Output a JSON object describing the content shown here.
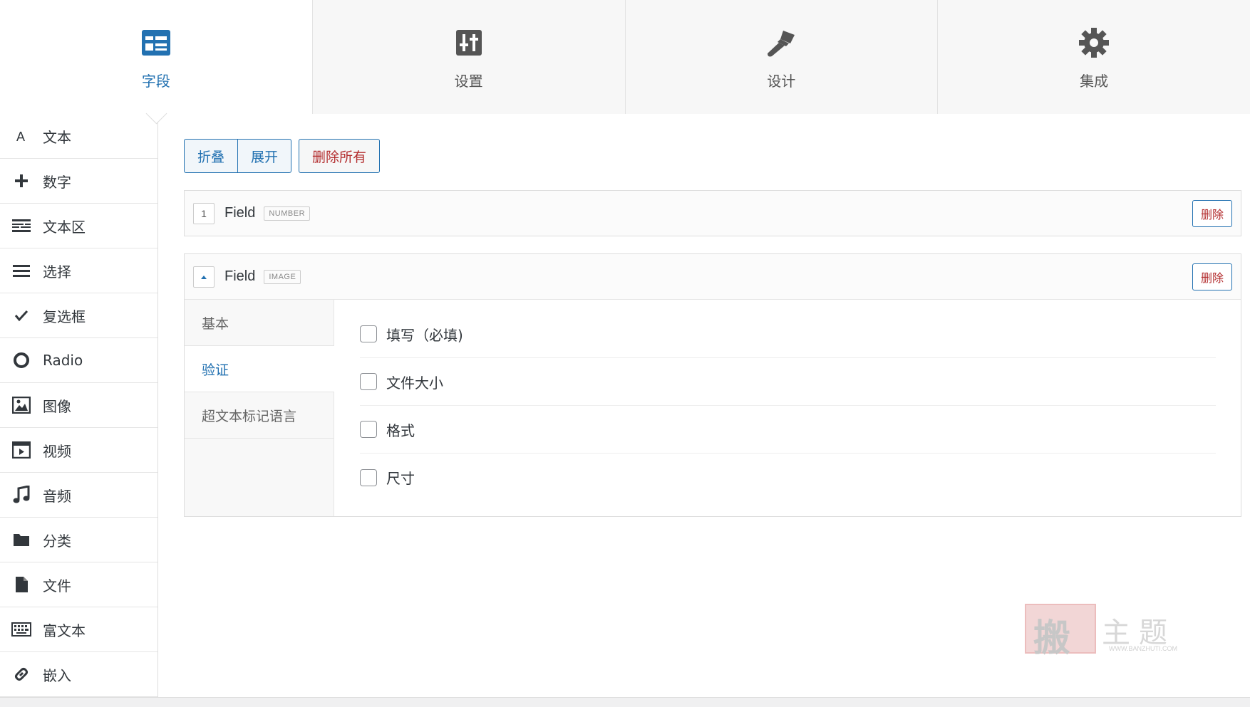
{
  "tabs": [
    {
      "label": "字段",
      "icon": "fields-icon",
      "active": true
    },
    {
      "label": "设置",
      "icon": "sliders-icon",
      "active": false
    },
    {
      "label": "设计",
      "icon": "brush-icon",
      "active": false
    },
    {
      "label": "集成",
      "icon": "gear-icon",
      "active": false
    }
  ],
  "sidebar": {
    "items": [
      {
        "label": "文本",
        "icon": "text-icon"
      },
      {
        "label": "数字",
        "icon": "plus-icon"
      },
      {
        "label": "文本区",
        "icon": "textarea-icon"
      },
      {
        "label": "选择",
        "icon": "menu-icon"
      },
      {
        "label": "复选框",
        "icon": "checkmark-icon"
      },
      {
        "label": "Radio",
        "icon": "radio-icon"
      },
      {
        "label": "图像",
        "icon": "image-icon"
      },
      {
        "label": "视频",
        "icon": "video-icon"
      },
      {
        "label": "音频",
        "icon": "music-icon"
      },
      {
        "label": "分类",
        "icon": "folder-icon"
      },
      {
        "label": "文件",
        "icon": "file-icon"
      },
      {
        "label": "富文本",
        "icon": "keyboard-icon"
      },
      {
        "label": "嵌入",
        "icon": "link-icon"
      }
    ]
  },
  "toolbar": {
    "collapse_label": "折叠",
    "expand_label": "展开",
    "delete_all_label": "删除所有"
  },
  "fields": [
    {
      "number": "1",
      "title": "Field",
      "type": "NUMBER",
      "delete_label": "删除"
    },
    {
      "title": "Field",
      "type": "IMAGE",
      "delete_label": "删除",
      "subtabs": [
        "基本",
        "验证",
        "超文本标记语言"
      ],
      "active_subtab": "验证",
      "options": [
        "填写（必填)",
        "文件大小",
        "格式",
        "尺寸"
      ]
    }
  ],
  "watermark": {
    "seal_char": "搬",
    "text": "主题",
    "url": "WWW.BANZHUTI.COM"
  },
  "colors": {
    "accent": "#2271b1",
    "danger": "#b32d2e"
  }
}
